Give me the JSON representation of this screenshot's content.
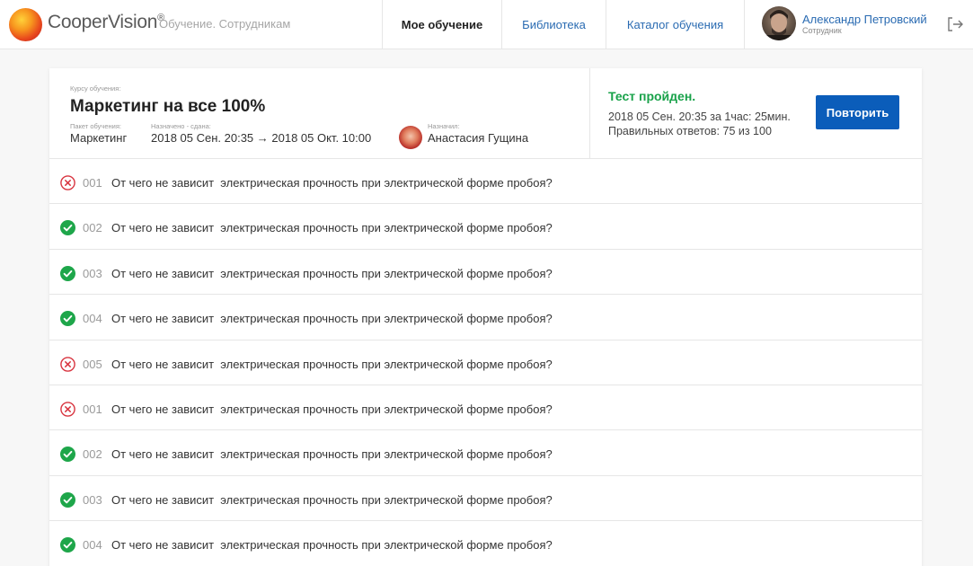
{
  "header": {
    "logo_text": "CooperVision",
    "logo_mark": "®",
    "subtitle": "Обучение. Сотрудникам",
    "nav": [
      {
        "label": "Мое обучение",
        "active": true
      },
      {
        "label": "Библиотека",
        "active": false
      },
      {
        "label": "Каталог обучения",
        "active": false
      }
    ],
    "user": {
      "name": "Александр Петровский",
      "role": "Сотрудник"
    },
    "logout_icon": "logout-icon"
  },
  "course": {
    "caption": "Курсу обучения:",
    "title": "Маркетинг на все 100%",
    "package_caption": "Пакет обучения:",
    "package": "Маркетинг",
    "dates_caption": "Назначено - сдана:",
    "dates": "2018 05 Сен. 20:35 → 2018 05 Окт. 10:00",
    "assigner_caption": "Назначил:",
    "assigner": "Анастасия Гущина"
  },
  "result": {
    "title": "Тест пройден.",
    "line1": "2018 05 Сен. 20:35 за 1час: 25мин.",
    "line2": "Правильных ответов: 75 из 100",
    "button": "Повторить"
  },
  "colors": {
    "correct": "#1ea64a",
    "wrong": "#d8343f",
    "accent": "#0b5dba"
  },
  "questions": [
    {
      "num": "001",
      "text": "От чего не зависит  электрическая прочность при электрической форме пробоя?",
      "status": "wrong"
    },
    {
      "num": "002",
      "text": "От чего не зависит  электрическая прочность при электрической форме пробоя?",
      "status": "correct"
    },
    {
      "num": "003",
      "text": "От чего не зависит  электрическая прочность при электрической форме пробоя?",
      "status": "correct"
    },
    {
      "num": "004",
      "text": "От чего не зависит  электрическая прочность при электрической форме пробоя?",
      "status": "correct"
    },
    {
      "num": "005",
      "text": "От чего не зависит  электрическая прочность при электрической форме пробоя?",
      "status": "wrong"
    },
    {
      "num": "001",
      "text": "От чего не зависит  электрическая прочность при электрической форме пробоя?",
      "status": "wrong"
    },
    {
      "num": "002",
      "text": "От чего не зависит  электрическая прочность при электрической форме пробоя?",
      "status": "correct"
    },
    {
      "num": "003",
      "text": "От чего не зависит  электрическая прочность при электрической форме пробоя?",
      "status": "correct"
    },
    {
      "num": "004",
      "text": "От чего не зависит  электрическая прочность при электрической форме пробоя?",
      "status": "correct"
    }
  ]
}
